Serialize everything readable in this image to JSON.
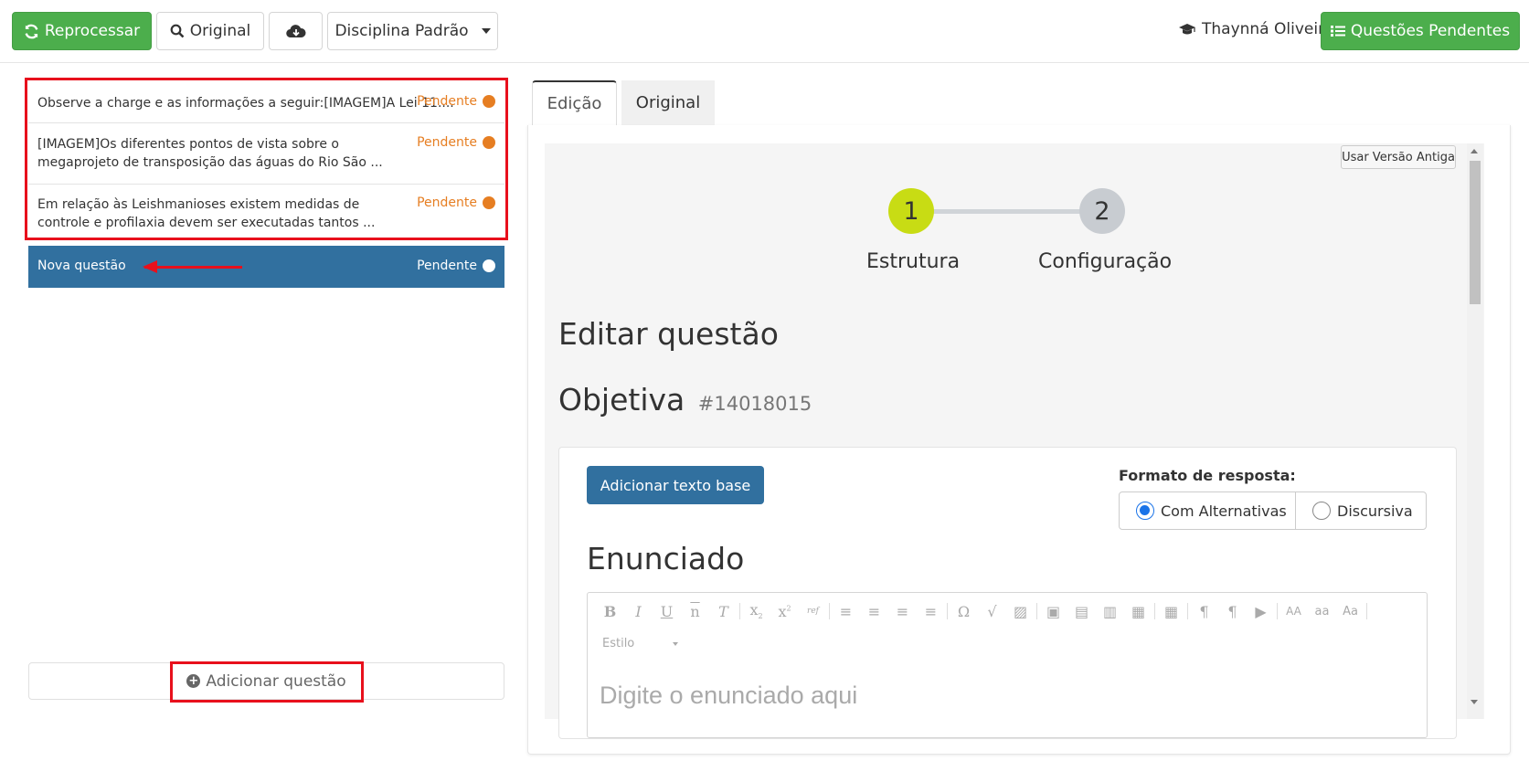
{
  "header": {
    "reprocess_label": "Reprocessar",
    "original_label": "Original",
    "discipline_label": "Disciplina Padrão",
    "user_name": "Thaynná Oliveira",
    "pending_label": "Questões Pendentes"
  },
  "questions": [
    {
      "text": "Observe a charge e as informações a seguir:[IMAGEM]A Lei 11....",
      "status": "Pendente"
    },
    {
      "text": "[IMAGEM]Os diferentes pontos de vista sobre o megaprojeto de transposição das águas do Rio São ...",
      "status": "Pendente"
    },
    {
      "text": "Em relação às Leishmanioses existem medidas de controle e profilaxia devem ser executadas tantos ...",
      "status": "Pendente"
    }
  ],
  "new_question": {
    "label": "Nova questão",
    "status": "Pendente"
  },
  "add_question_label": "Adicionar questão",
  "tabs": [
    {
      "label": "Edição"
    },
    {
      "label": "Original"
    }
  ],
  "old_version_label": "Usar Versão Antiga",
  "steps": [
    {
      "number": "1",
      "label": "Estrutura"
    },
    {
      "number": "2",
      "label": "Configuração"
    }
  ],
  "edit_title": "Editar questão",
  "question_type": "Objetiva",
  "question_code": "#14018015",
  "add_base_text_label": "Adicionar texto base",
  "answer_format": {
    "label": "Formato de resposta:",
    "options": [
      "Com Alternativas",
      "Discursiva"
    ],
    "selected": "Com Alternativas"
  },
  "statement_title": "Enunciado",
  "editor": {
    "style_label": "Estilo",
    "placeholder": "Digite o enunciado aqui"
  },
  "colors": {
    "green": "#4cae4c",
    "blue": "#31709f",
    "pending": "#e67e22",
    "step_active": "#c8dc14",
    "highlight": "#e8101c"
  }
}
